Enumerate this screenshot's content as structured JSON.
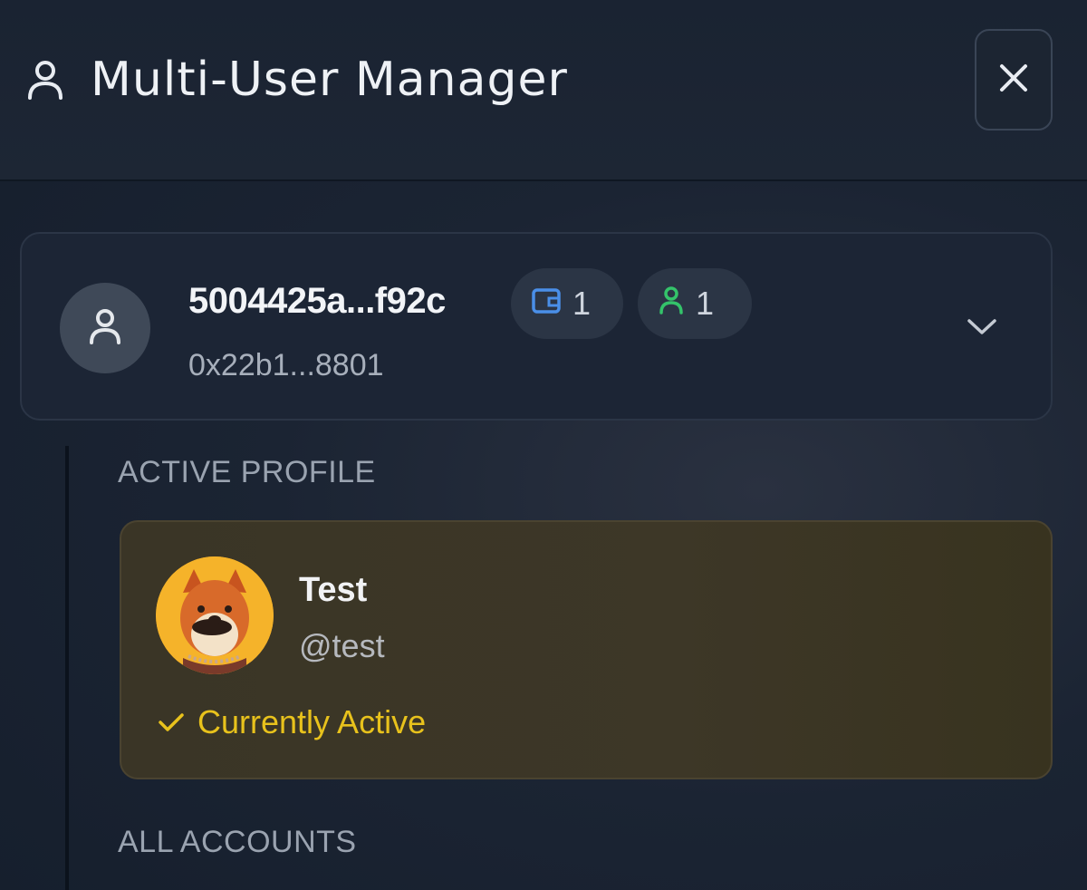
{
  "header": {
    "title": "Multi-User Manager",
    "icon": "user-icon",
    "close_icon": "close-icon"
  },
  "account": {
    "name": "5004425a...f92c",
    "address": "0x22b1...8801",
    "wallet_count": "1",
    "user_count": "1",
    "wallet_icon_color": "#4a8fe8",
    "user_icon_color": "#34c36a"
  },
  "active_profile": {
    "section_label": "ACTIVE PROFILE",
    "name": "Test",
    "handle": "@test",
    "status": "Currently Active",
    "status_color": "#e8c21c"
  },
  "all_accounts": {
    "section_label": "ALL ACCOUNTS"
  }
}
